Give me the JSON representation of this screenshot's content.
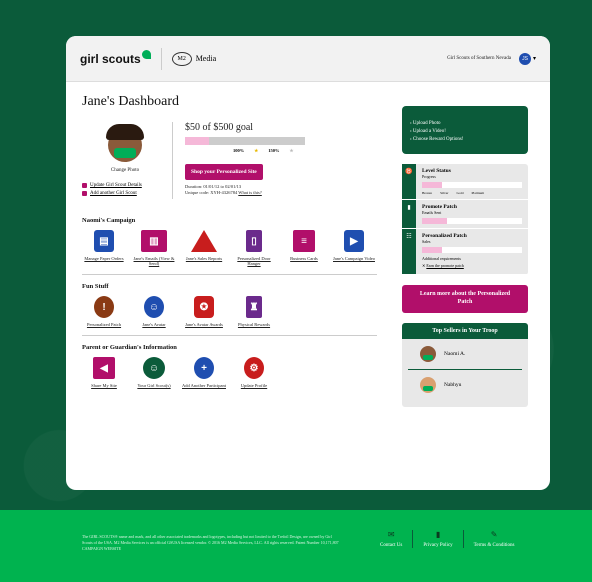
{
  "header": {
    "brand": "girl scouts",
    "partner_mark": "M2",
    "partner_name": "Media",
    "council": "Girl Scouts of Southern Nevada",
    "user_initials": "JS"
  },
  "dashboard": {
    "title": "Jane's Dashboard",
    "change_photo": "Change Photo",
    "update_details": "Update Girl Scout Details",
    "add_scout": "Add another Girl Scout",
    "goal_amount": "$50",
    "goal_text": "of $500 goal",
    "progress_fraction": 0.1,
    "mark_100": "100%",
    "mark_150": "150%",
    "shop_button": "Shop your Personalized Site",
    "duration": "Duration: 01/01/12 to 02/01/13",
    "unique_code": "Unique code: XYH-4326784",
    "what_is_this": "What is this?"
  },
  "campaign": {
    "heading": "Naomi's Campaign",
    "items": [
      "Manage Paper Orders",
      "Jane's Emails (View & Send)",
      "Jane's Sales Reports",
      "Personalized Door Hanger",
      "Business Cards",
      "Jane's Campaign Video"
    ]
  },
  "fun": {
    "heading": "Fun Stuff",
    "items": [
      "Personalized Patch",
      "Jane's Avatar",
      "Jane's Avatar Awards",
      "Physical Rewards"
    ]
  },
  "parent": {
    "heading": "Parent or Guardian's Information",
    "items": [
      "Share My Site",
      "Your Girl Scout(s)",
      "Add Another Participant",
      "Update Profile"
    ]
  },
  "todo": {
    "items": [
      "Upload Photo",
      "Upload a Video!",
      "Choose Reward Options!"
    ]
  },
  "level": {
    "title": "Level Status",
    "sub": "Progress",
    "ticks": [
      "Bronze",
      "Silver",
      "Gold",
      "Platinum"
    ],
    "fraction": 0.2
  },
  "promote": {
    "title": "Promote Patch",
    "sub": "Emails Sent",
    "fraction": 0.25
  },
  "personalized": {
    "title": "Personalized Patch",
    "sub": "Sales",
    "fraction": 0.2,
    "note": "Additional requirements",
    "link": "Earn the promote patch"
  },
  "learn_more": "Learn more about the Personalized Patch",
  "sellers": {
    "heading": "Top Sellers in Your Troop",
    "names": [
      "Naomi A.",
      "Nabhyu"
    ]
  },
  "footer": {
    "legal": "The GIRL SCOUTS® name and mark, and all other associated trademarks and logotypes, including but not limited to the Trefoil Design, are owned by Girl Scouts of the USA. M2 Media Services is an official GSUSA licensed vendor. © 2016 M2 Media Services, LLC. All rights reserved. Patent Number 10,171,807 CAMPAIGN WEBSITE",
    "links": [
      "Contact Us",
      "Privacy Policy",
      "Terms & Conditions"
    ]
  },
  "colors": {
    "green": "#0b5b3a",
    "pink": "#b10f6a",
    "bright_green": "#00b34f"
  }
}
